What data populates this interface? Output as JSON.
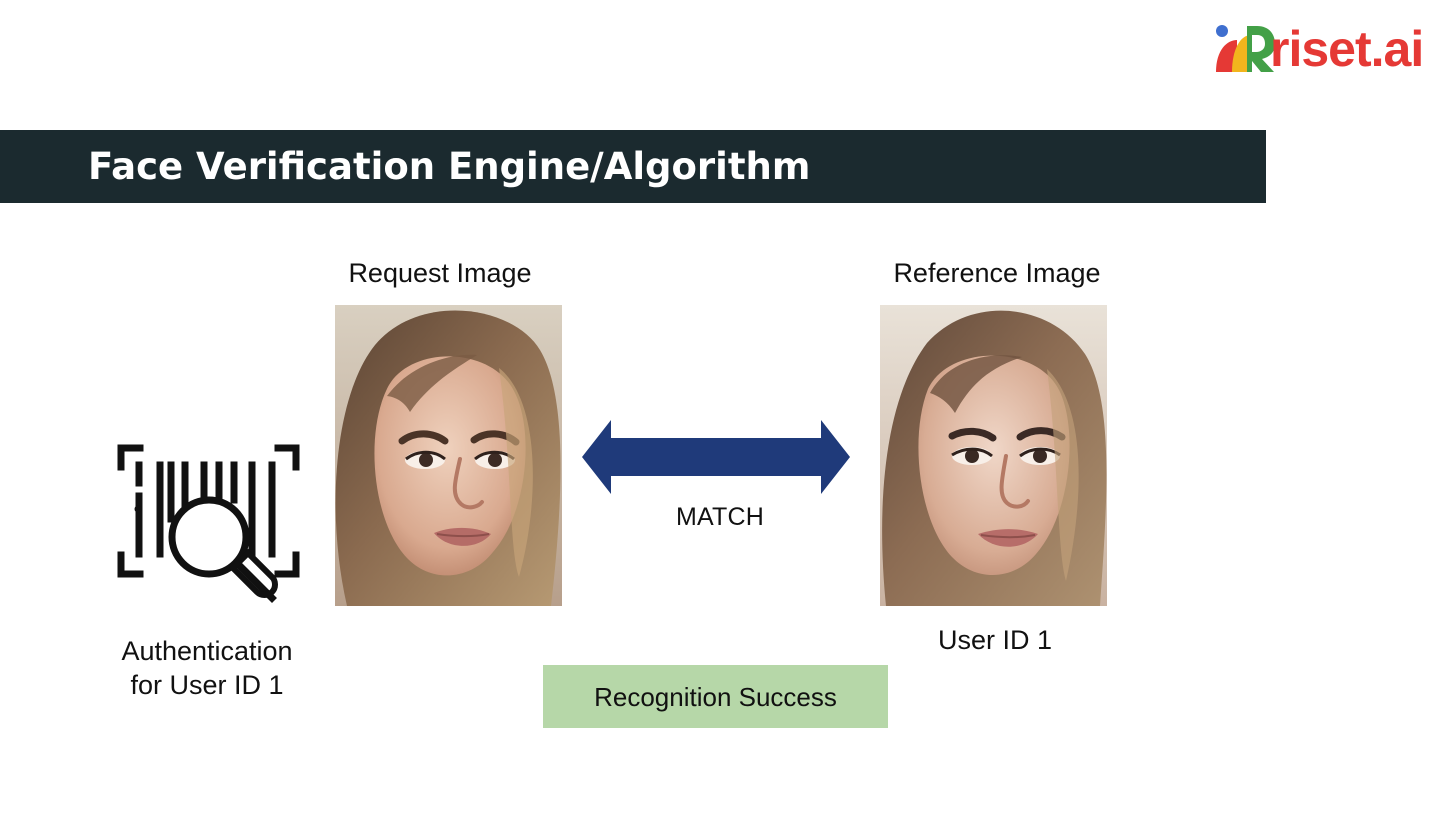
{
  "brand": {
    "logo_text": "riset.ai",
    "logo_icon": "riset-logo-icon",
    "logo_colors": {
      "red": "#e53935",
      "yellow": "#f2b51d",
      "green": "#43a047",
      "blue": "#3f6fcf"
    }
  },
  "header": {
    "title": "Face Verification Engine/Algorithm",
    "background_color": "#1b2a2f",
    "text_color": "#ffffff"
  },
  "diagram": {
    "request": {
      "label": "Request Image",
      "image_icon": "face-photo"
    },
    "reference": {
      "label": "Reference Image",
      "image_icon": "face-photo",
      "user_label": "User ID 1"
    },
    "authentication": {
      "icon": "barcode-search-icon",
      "label_line_1": "Authentication",
      "label_line_2": "for User ID 1"
    },
    "connector": {
      "icon": "double-arrow-icon",
      "label": "MATCH",
      "color": "#1f3a7a"
    },
    "result": {
      "label": "Recognition Success",
      "background_color": "#b6d7a8"
    }
  }
}
